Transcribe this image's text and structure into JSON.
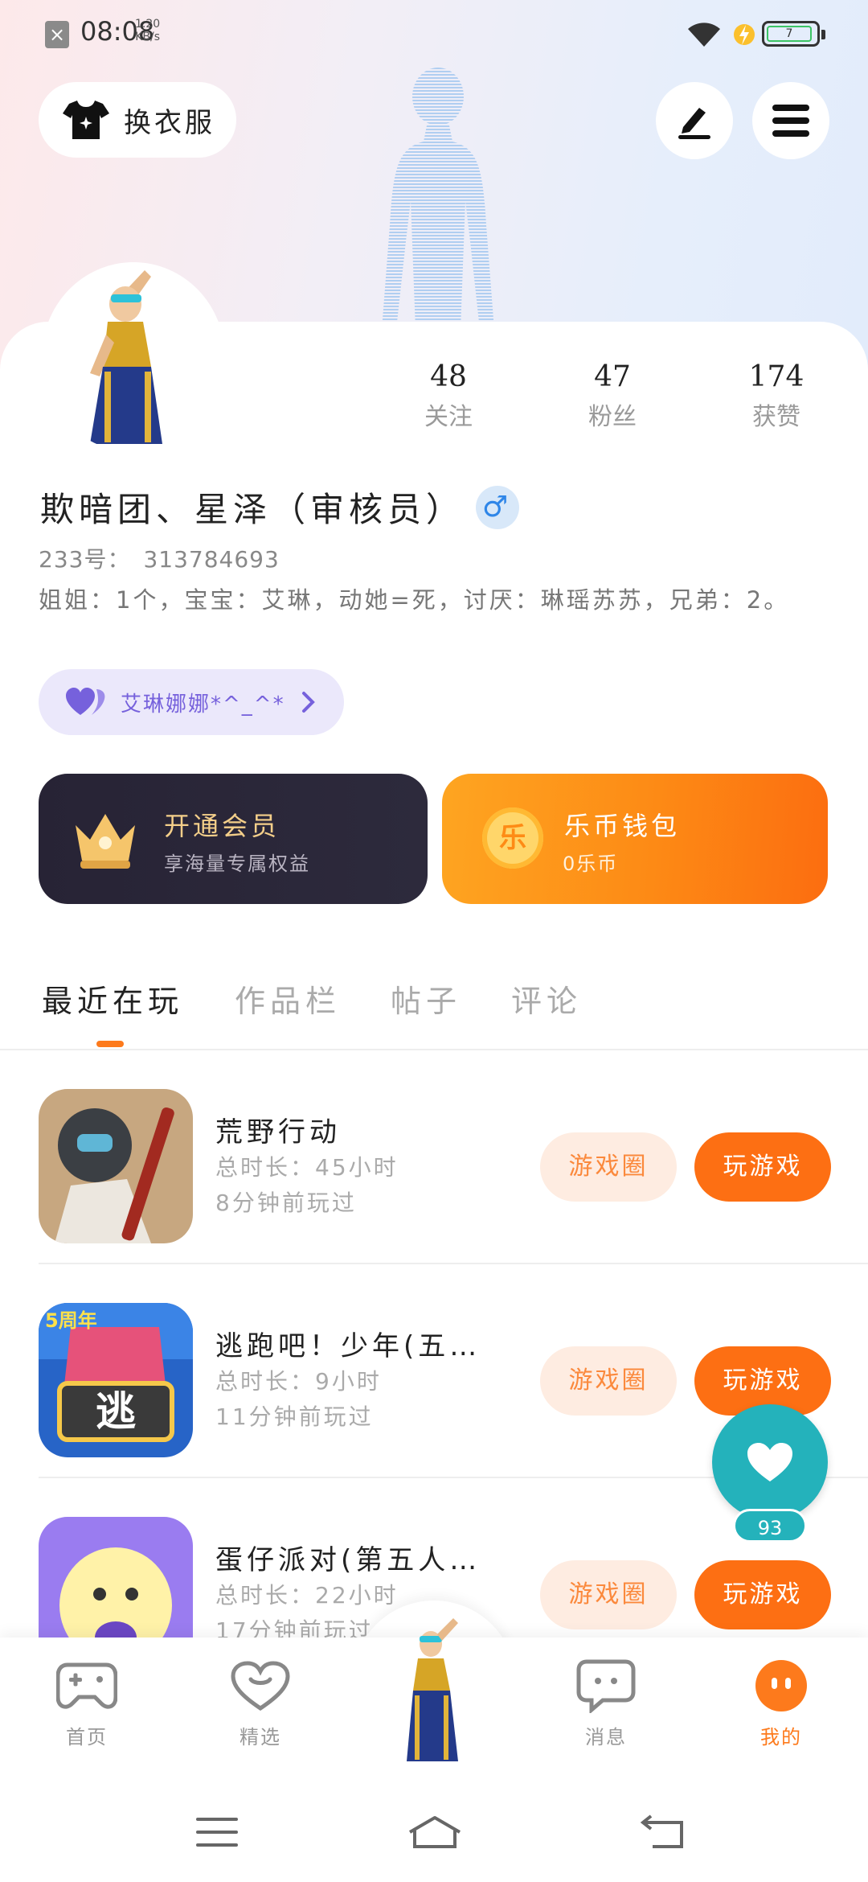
{
  "status_bar": {
    "time": "08:08",
    "speed_value": "1.20",
    "speed_unit": "KB/s",
    "battery": "7"
  },
  "header": {
    "dress_label": "换衣服"
  },
  "profile": {
    "stats": [
      {
        "value": "48",
        "label": "关注"
      },
      {
        "value": "47",
        "label": "粉丝"
      },
      {
        "value": "174",
        "label": "获赞"
      }
    ],
    "nickname": "欺暗团、星泽（审核员）",
    "gender_symbol": "♂",
    "uid_label": "233号：",
    "uid_value": "313784693",
    "bio": "姐姐：1个，宝宝：艾琳，动她=死，讨厌：琳瑶苏苏，兄弟：2。",
    "relation_label": "艾琳娜娜*^_^*"
  },
  "cards": {
    "vip": {
      "title": "开通会员",
      "subtitle": "享海量专属权益"
    },
    "wallet": {
      "title": "乐币钱包",
      "subtitle": "0乐币",
      "coin_char": "乐"
    }
  },
  "tabs": [
    "最近在玩",
    "作品栏",
    "帖子",
    "评论"
  ],
  "games": [
    {
      "name": "荒野行动",
      "total_time": "总时长：45小时",
      "last_played": "8分钟前玩过",
      "circle_label": "游戏圈",
      "play_label": "玩游戏"
    },
    {
      "name": "逃跑吧！少年(五…",
      "total_time": "总时长：9小时",
      "last_played": "11分钟前玩过",
      "circle_label": "游戏圈",
      "play_label": "玩游戏",
      "icon_badge": "5周年",
      "icon_char": "逃"
    },
    {
      "name": "蛋仔派对(第五人…",
      "total_time": "总时长：22小时",
      "last_played": "17分钟前玩过",
      "circle_label": "游戏圈",
      "play_label": "玩游戏"
    }
  ],
  "like_float": {
    "count": "93"
  },
  "bottom_nav": [
    {
      "label": "首页"
    },
    {
      "label": "精选"
    },
    {
      "label": "消息"
    },
    {
      "label": "我的"
    }
  ],
  "colors": {
    "accent": "#fd7a1c",
    "teal": "#24b2bb",
    "purple": "#7661dc"
  }
}
